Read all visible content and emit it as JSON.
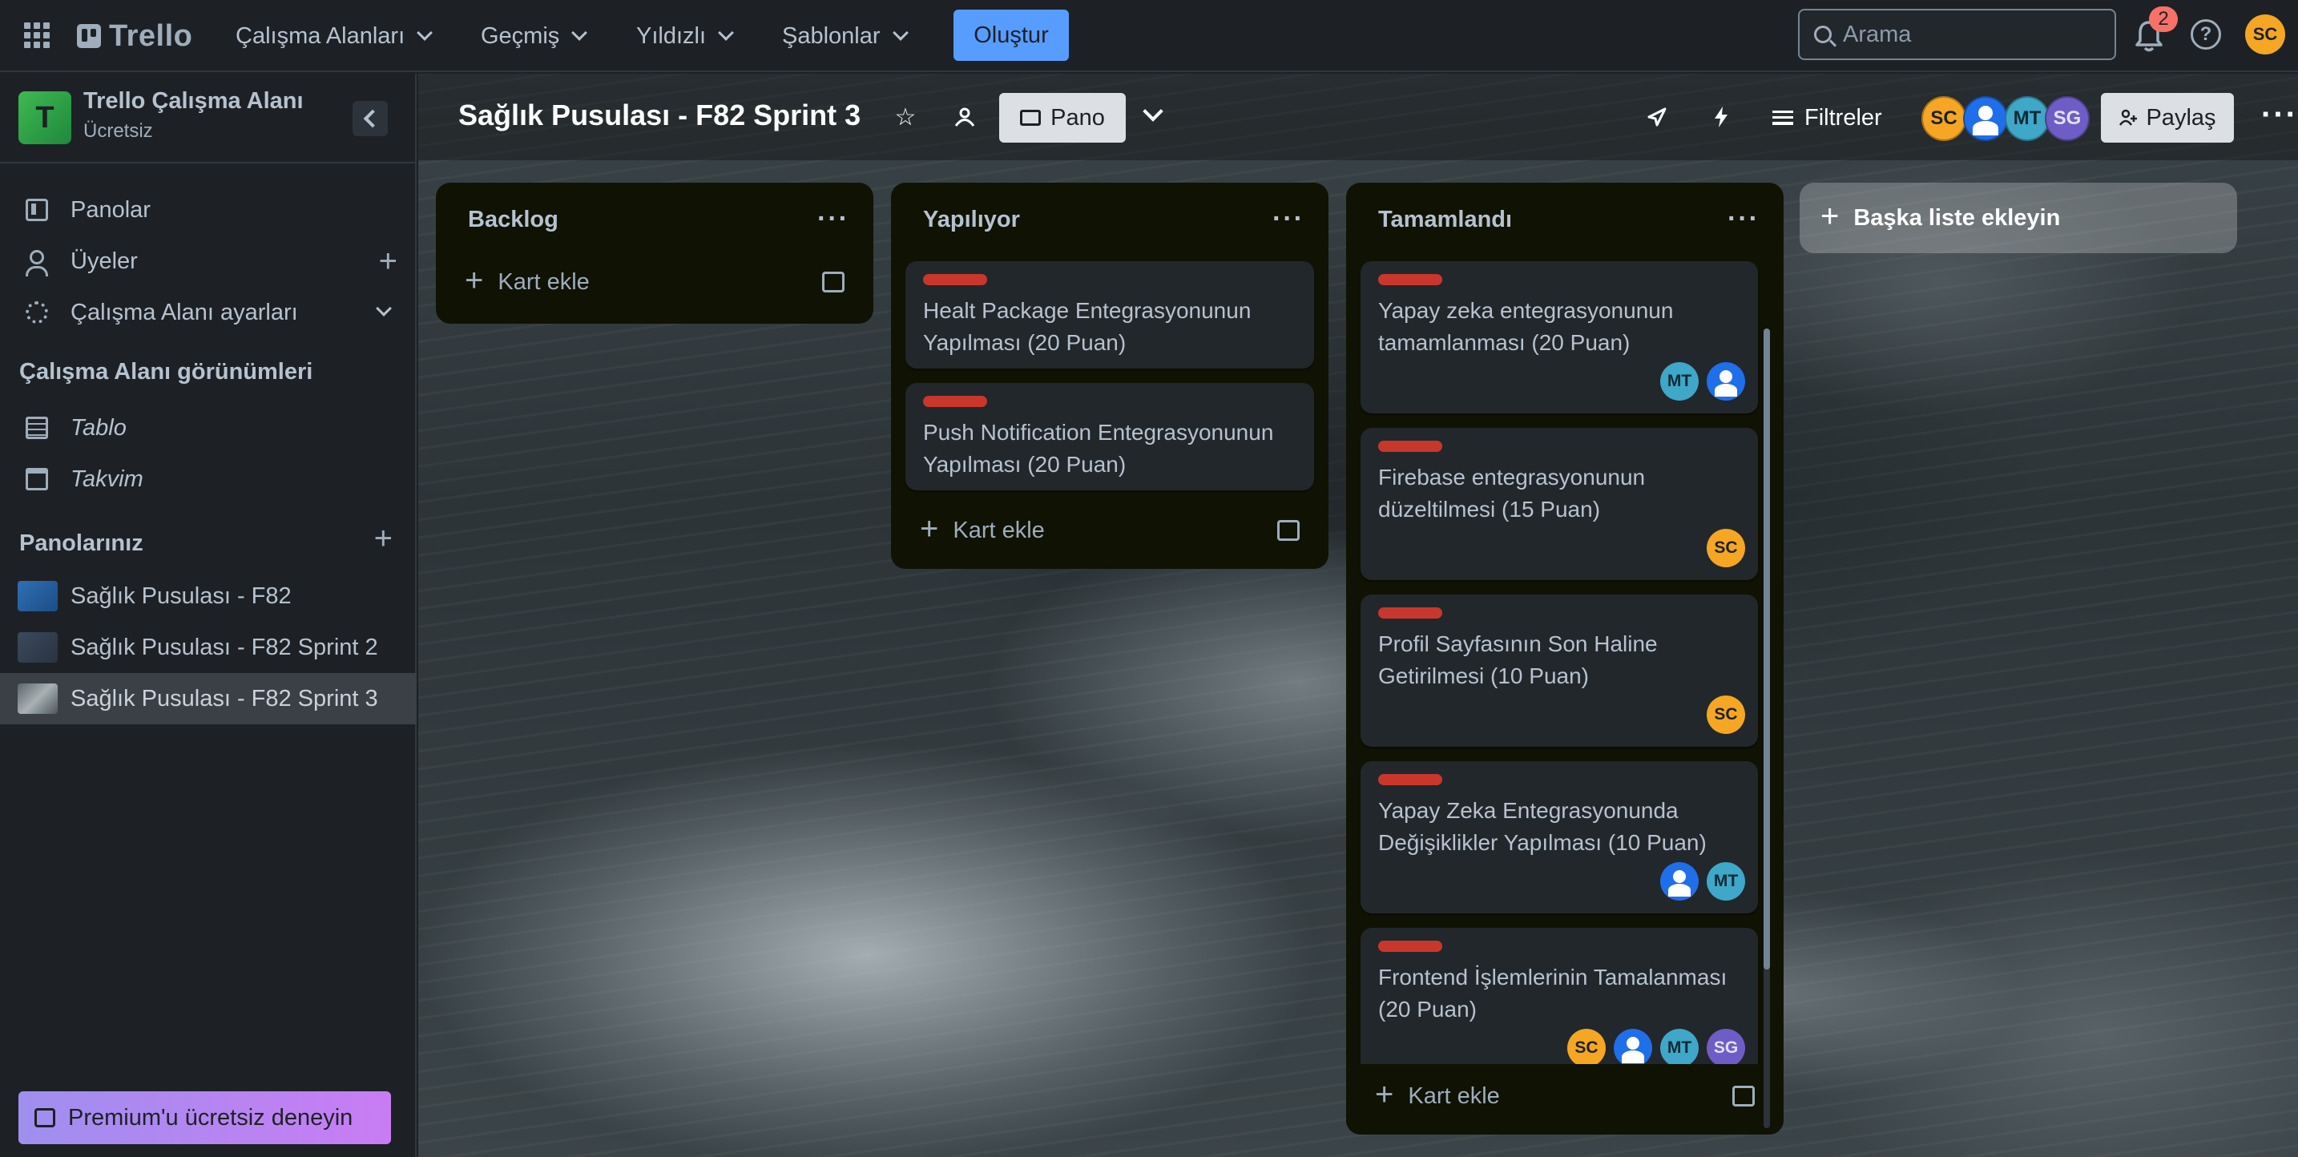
{
  "topbar": {
    "logo_text": "Trello",
    "menus": [
      {
        "label": "Çalışma Alanları"
      },
      {
        "label": "Geçmiş"
      },
      {
        "label": "Yıldızlı"
      },
      {
        "label": "Şablonlar"
      }
    ],
    "create_label": "Oluştur",
    "search_placeholder": "Arama",
    "notifications_count": "2",
    "help_glyph": "?",
    "user_initials": "SC"
  },
  "sidebar": {
    "workspace_initial": "T",
    "workspace_name": "Trello Çalışma Alanı",
    "workspace_plan": "Ücretsiz",
    "items": [
      {
        "label": "Panolar",
        "icon": "board-icon"
      },
      {
        "label": "Üyeler",
        "icon": "members-icon"
      },
      {
        "label": "Çalışma Alanı ayarları",
        "icon": "gear-icon"
      }
    ],
    "views_heading": "Çalışma Alanı görünümleri",
    "views": [
      {
        "label": "Tablo",
        "icon": "table-icon"
      },
      {
        "label": "Takvim",
        "icon": "calendar-icon"
      }
    ],
    "boards_heading": "Panolarınız",
    "boards": [
      {
        "label": "Sağlık Pusulası - F82",
        "color": "#2f6fb5"
      },
      {
        "label": "Sağlık Pusulası - F82 Sprint 2",
        "color": "#3a4a5e"
      },
      {
        "label": "Sağlık Pusulası - F82 Sprint 3",
        "color": "#7f8a90",
        "active": true
      }
    ],
    "premium_label": "Premium'u ücretsiz deneyin"
  },
  "board": {
    "title": "Sağlık Pusulası - F82 Sprint 3",
    "view_label": "Pano",
    "filter_label": "Filtreler",
    "share_label": "Paylaş",
    "members": [
      "SC",
      "",
      "MT",
      "SG"
    ],
    "add_list_label": "Başka liste ekleyin",
    "add_card_label": "Kart ekle",
    "lists": [
      {
        "title": "Backlog",
        "cards": []
      },
      {
        "title": "Yapılıyor",
        "cards": [
          {
            "title": "Healt Package Entegrasyonunun Yapılması (20 Puan)",
            "label_color": "#c9372c"
          },
          {
            "title": "Push Notification Entegrasyonunun Yapılması (20 Puan)",
            "label_color": "#c9372c"
          }
        ]
      },
      {
        "title": "Tamamlandı",
        "cards": [
          {
            "title": "Yapay zeka entegrasyonunun tamamlanması (20 Puan)",
            "label_color": "#c9372c",
            "members": [
              "MT",
              ""
            ]
          },
          {
            "title": "Firebase entegrasyonunun düzeltilmesi (15 Puan)",
            "label_color": "#c9372c",
            "members": [
              "SC"
            ]
          },
          {
            "title": "Profil Sayfasının Son Haline Getirilmesi (10 Puan)",
            "label_color": "#c9372c",
            "members": [
              "SC"
            ]
          },
          {
            "title": "Yapay Zeka Entegrasyonunda Değişiklikler Yapılması (10 Puan)",
            "label_color": "#c9372c",
            "members": [
              "",
              "MT"
            ]
          },
          {
            "title": "Frontend İşlemlerinin Tamalanması (20 Puan)",
            "label_color": "#c9372c",
            "members": [
              "SC",
              "",
              "MT",
              "SG"
            ]
          }
        ]
      }
    ]
  },
  "colors": {
    "accent": "#579dff",
    "label_red": "#c9372c",
    "list_bg": "#101204",
    "card_bg": "#22272b"
  }
}
